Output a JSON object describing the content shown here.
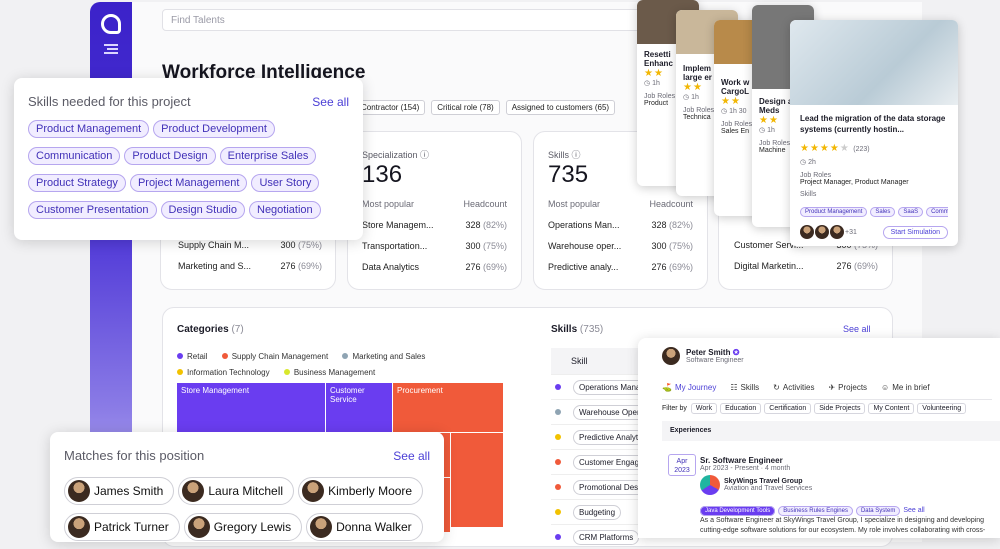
{
  "search": {
    "placeholder": "Find Talents"
  },
  "page": {
    "title": "Workforce Intelligence"
  },
  "filters": [
    "Contractor (154)",
    "Critical role (78)",
    "Assigned to customers (65)"
  ],
  "stats": [
    {
      "label": "Specialization",
      "value": "136",
      "rows": [
        [
          "Store Managem...",
          "328",
          "(82%)"
        ],
        [
          "Transportation...",
          "300",
          "(75%)"
        ],
        [
          "Data Analytics",
          "276",
          "(69%)"
        ]
      ]
    },
    {
      "label": "Skills",
      "value": "735",
      "rows": [
        [
          "Operations Man...",
          "328",
          "(82%)"
        ],
        [
          "Warehouse oper...",
          "300",
          "(75%)"
        ],
        [
          "Predictive analy...",
          "276",
          "(69%)"
        ]
      ]
    }
  ],
  "stat_common": {
    "most_popular": "Most popular",
    "headcount": "Headcount"
  },
  "stat0_tail": [
    [
      "Supply Chain M...",
      "300",
      "(75%)"
    ],
    [
      "Marketing and S...",
      "276",
      "(69%)"
    ]
  ],
  "stat3_tail": [
    [
      "Customer Servi...",
      "300",
      "(75%)"
    ],
    [
      "Digital Marketin...",
      "276",
      "(69%)"
    ]
  ],
  "categories": {
    "title": "Categories",
    "count": "(7)",
    "legend": [
      {
        "name": "Retail",
        "color": "#6a3df0"
      },
      {
        "name": "Supply Chain Management",
        "color": "#f05a3a"
      },
      {
        "name": "Marketing and Sales",
        "color": "#8fa4b3"
      },
      {
        "name": "Information Technology",
        "color": "#f2c200"
      },
      {
        "name": "Business Management",
        "color": "#d8e82c"
      }
    ],
    "cells": [
      "Store Management",
      "Customer Service",
      "Procurement"
    ]
  },
  "skills_table": {
    "title": "Skills",
    "count": "(735)",
    "see_all": "See all",
    "col": "Skill",
    "rows": [
      {
        "name": "Operations Mana",
        "color": "#6a3df0"
      },
      {
        "name": "Warehouse Oper",
        "color": "#8fa4b3"
      },
      {
        "name": "Predictive Analyt",
        "color": "#f2c200"
      },
      {
        "name": "Customer Engag",
        "color": "#f05a3a"
      },
      {
        "name": "Promotional Desi",
        "color": "#f05a3a"
      },
      {
        "name": "Budgeting",
        "color": "#f2c200"
      },
      {
        "name": "CRM Platforms",
        "color": "#6a3df0"
      }
    ]
  },
  "skills_project": {
    "title": "Skills needed for this project",
    "see_all": "See all",
    "items": [
      "Product Management",
      "Product Development",
      "Communication",
      "Product Design",
      "Enterprise Sales",
      "Product Strategy",
      "Project Management",
      "User Story",
      "Customer Presentation",
      "Design Studio",
      "Negotiation"
    ]
  },
  "matches": {
    "title": "Matches for this position",
    "see_all": "See all",
    "people": [
      "James Smith",
      "Laura Mitchell",
      "Kimberly Moore",
      "Patrick Turner",
      "Gregory Lewis",
      "Donna Walker"
    ]
  },
  "talent_cards": [
    {
      "title": "Resetti Enhanc",
      "sub": "Product",
      "time": "1h",
      "color": "#6b5a4a"
    },
    {
      "title": "Implem large er",
      "sub": "Technica",
      "time": "1h",
      "color": "#c9b79a"
    },
    {
      "title": "Work w CargoL",
      "sub": "Sales En",
      "time": "1h 30",
      "color": "#b88a4a"
    },
    {
      "title": "Design at Meds",
      "sub": "Machine",
      "time": "1h",
      "color": "#777777"
    }
  ],
  "featured_card": {
    "title": "Lead the migration of the data storage systems (currently hostin...",
    "rating": "(223)",
    "time": "2h",
    "job_roles_label": "Job Roles",
    "job_roles": "Project Manager, Product Manager",
    "skills_label": "Skills",
    "skills": [
      "Product Management",
      "Sales",
      "SaaS",
      "Communication"
    ],
    "more": "+31",
    "button": "Start Simulation"
  },
  "profile": {
    "name": "Peter Smith",
    "role": "Software Engineer",
    "tabs": [
      "My Journey",
      "Skills",
      "Activities",
      "Projects",
      "Me in brief"
    ],
    "filter_label": "Filter by",
    "filters": [
      "Work",
      "Education",
      "Certification",
      "Side Projects",
      "My Content",
      "Volunteering"
    ],
    "section": "Experiences",
    "month": "Apr",
    "year": "2023",
    "job_title": "Sr. Software Engineer",
    "job_dates": "Apr 2023 - Present · 4 month",
    "company": "SkyWings Travel Group",
    "industry": "Aviation and Travel Services",
    "job_tags": [
      "Java Development Tools",
      "Business Rules Engines",
      "Data System"
    ],
    "job_see_all": "See all",
    "description": "As a Software Engineer at SkyWings Travel Group, I specialize in designing and developing cutting-edge software solutions for our ecosystem. My role involves collaborating with cross-functional teams to enhance"
  }
}
